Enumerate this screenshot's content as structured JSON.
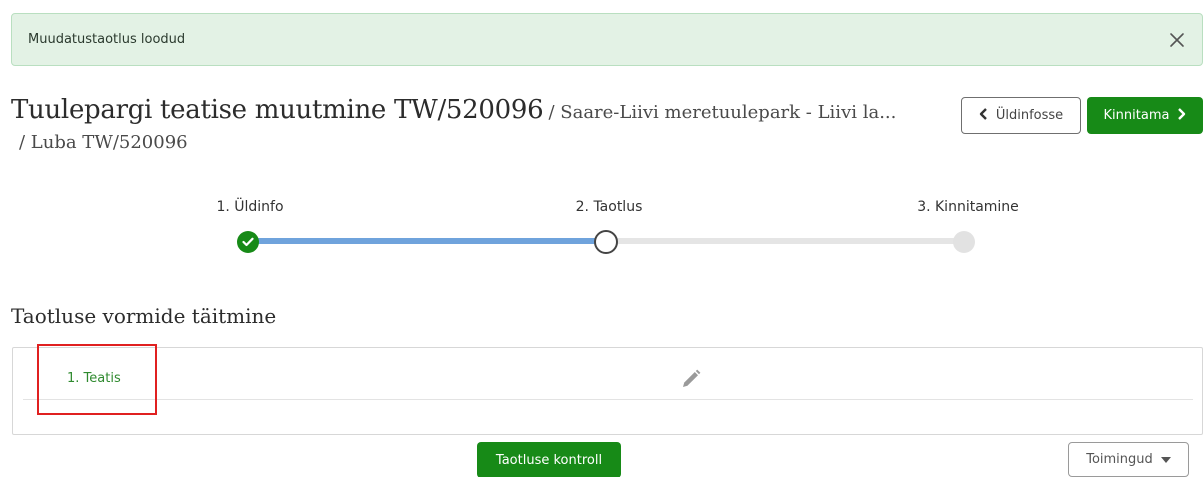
{
  "alert": {
    "message": "Muudatustaotlus loodud",
    "close_icon": "close-icon"
  },
  "header": {
    "title": "Tuulepargi teatise muutmine TW/520096",
    "crumb_1": "/ Saare-Liivi meretuulepark - Liivi la...",
    "crumb_2": "/ Luba TW/520096",
    "back_button": "Üldinfosse",
    "confirm_button": "Kinnitama"
  },
  "stepper": {
    "steps": [
      {
        "label": "1. Üldinfo",
        "state": "done"
      },
      {
        "label": "2. Taotlus",
        "state": "current"
      },
      {
        "label": "3. Kinnitamine",
        "state": "pending"
      }
    ],
    "progress_fraction": 0.5
  },
  "section": {
    "title": "Taotluse vormide täitmine",
    "forms": [
      {
        "label": "1. Teatis",
        "icon": "pencil-icon"
      }
    ]
  },
  "footer": {
    "check_button": "Taotluse kontroll",
    "actions_button": "Toimingud"
  },
  "colors": {
    "accent_green": "#178a17",
    "alert_bg": "#e3f2e5",
    "progress_blue": "#6fa3dc",
    "highlight_red": "#e02020"
  }
}
